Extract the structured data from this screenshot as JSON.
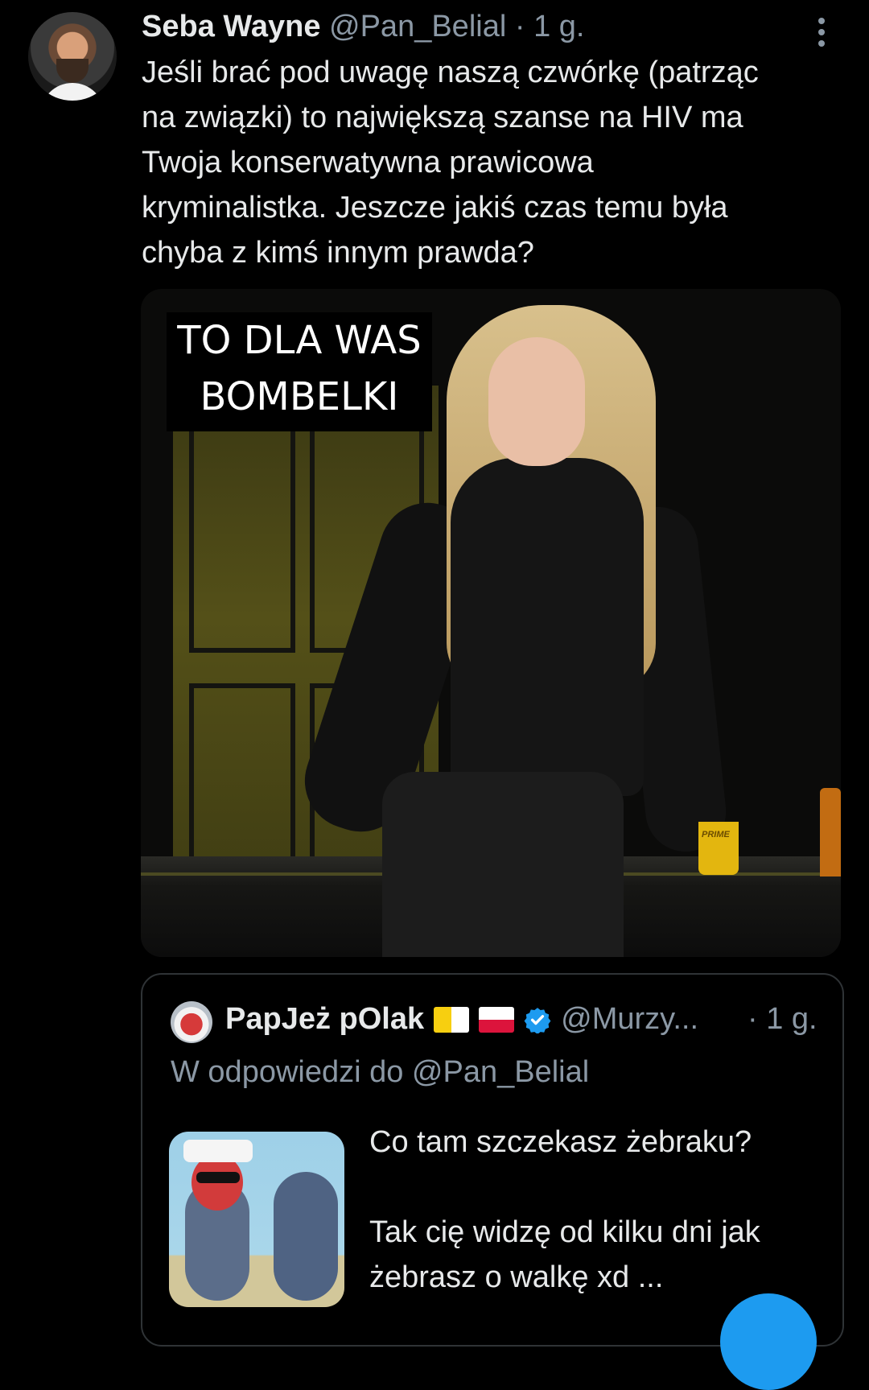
{
  "tweet": {
    "name": "Seba Wayne",
    "handle": "@Pan_Belial",
    "dot": "·",
    "time": "1 g.",
    "text": "Jeśli brać pod uwagę naszą czwórkę (patrząc\nna związki) to największą szanse na HIV ma\nTwoja konserwatywna prawicowa\nkryminalistka. Jeszcze jakiś czas temu była\nchyba z kimś innym prawda?",
    "media": {
      "caption": "TO DLA WAS\nBOMBELKI",
      "cup_label": "PRIME"
    }
  },
  "quoted_tweet": {
    "name": "PapJeż pOlak",
    "flags": [
      "vatican-flag",
      "poland-flag"
    ],
    "verified": true,
    "handle": "@Murzy...",
    "time": "· 1 g.",
    "reply_to": "W odpowiedzi do @Pan_Belial",
    "text": "Co tam szczekasz żebraku?\n\nTak cię widzę od kilku dni jak\nżebrasz o walkę xd ..."
  },
  "colors": {
    "background": "#000000",
    "text": "#e7e9ea",
    "secondary": "#8b98a5",
    "border": "#2f3336",
    "accent": "#1d9bf0"
  }
}
